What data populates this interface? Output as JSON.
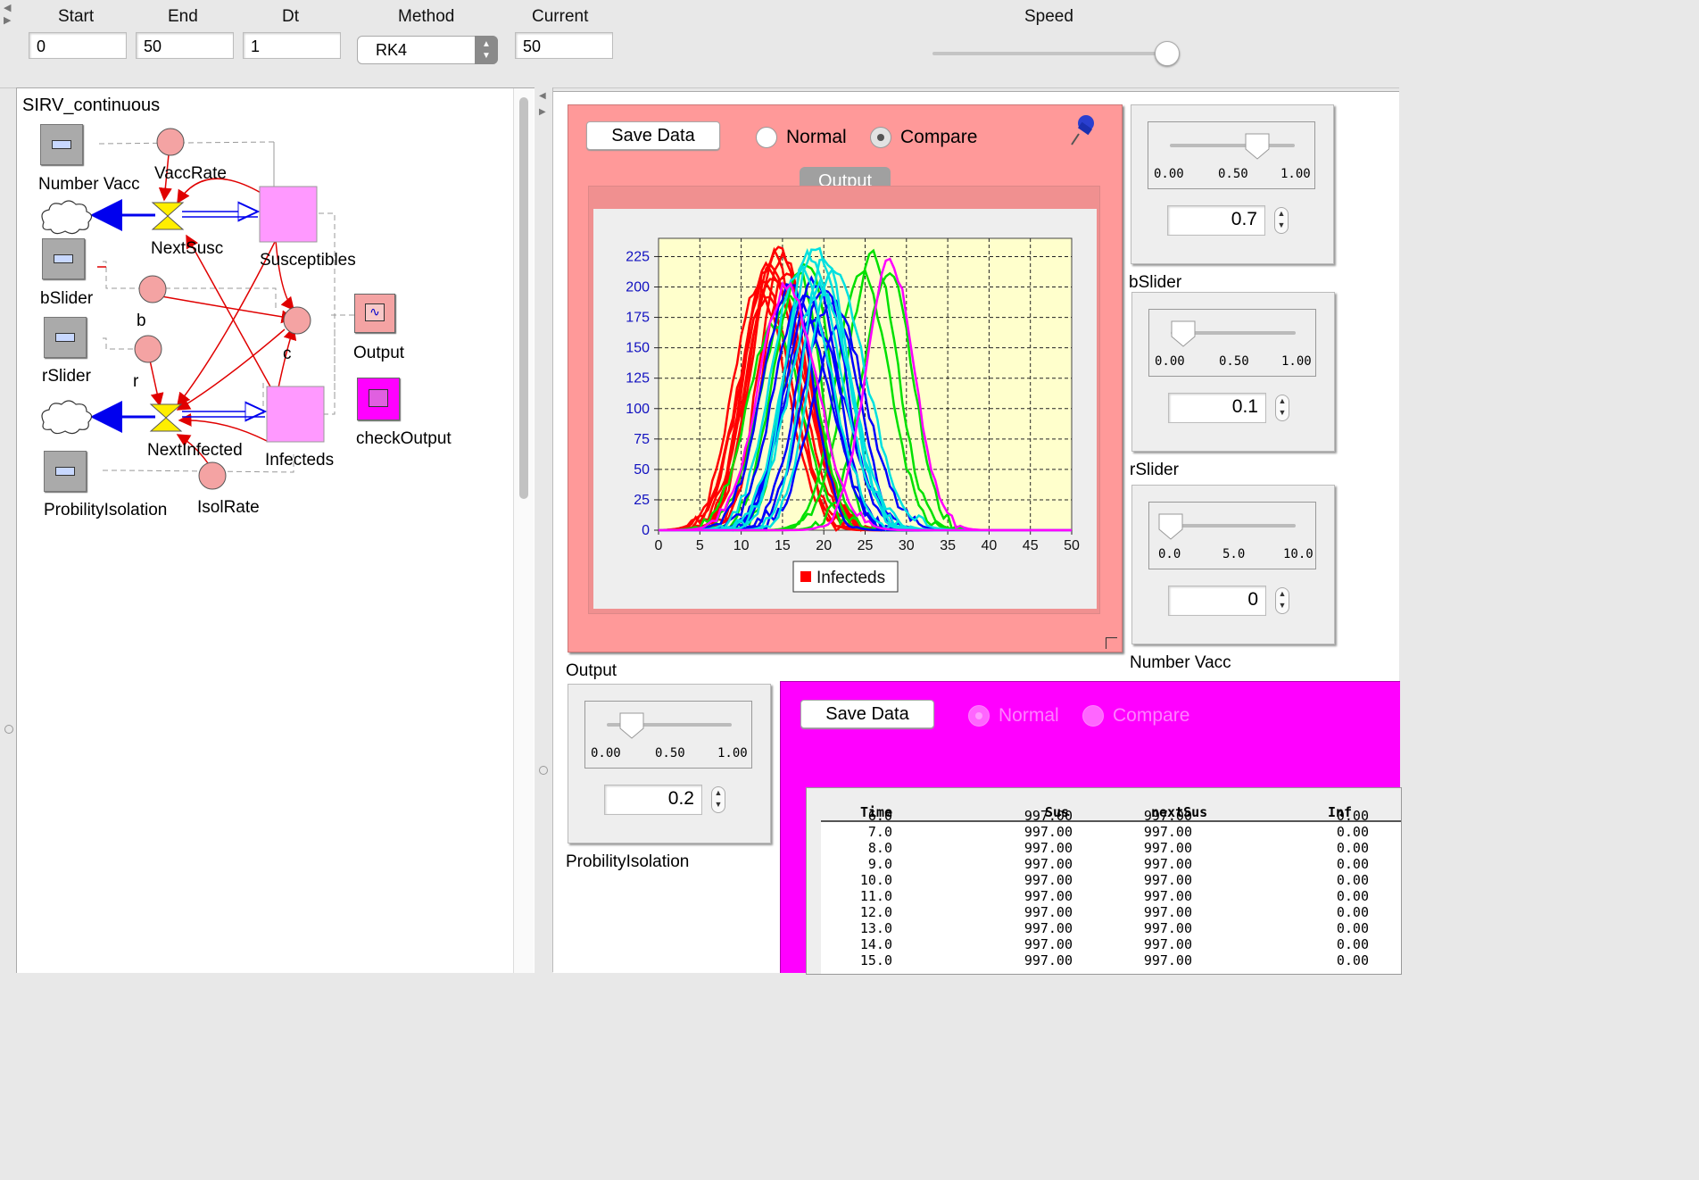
{
  "toolbar": {
    "start_label": "Start",
    "start_value": "0",
    "end_label": "End",
    "end_value": "50",
    "dt_label": "Dt",
    "dt_value": "1",
    "method_label": "Method",
    "method_value": "RK4",
    "current_label": "Current",
    "current_value": "50",
    "speed_label": "Speed",
    "speed_level": 0.97
  },
  "model": {
    "title": "SIRV_continuous",
    "nodes": {
      "number_vacc": "Number Vacc",
      "vacc_rate": "VaccRate",
      "next_susc": "NextSusc",
      "susceptibles": "Susceptibles",
      "bslider": "bSlider",
      "b": "b",
      "c": "c",
      "output": "Output",
      "rslider": "rSlider",
      "r": "r",
      "next_infected": "NextInfected",
      "infecteds": "Infecteds",
      "check_output": "checkOutput",
      "probility_isolation": "ProbilityIsolation",
      "isol_rate": "IsolRate"
    }
  },
  "output_panel": {
    "save_label": "Save Data",
    "normal_label": "Normal",
    "compare_label": "Compare",
    "selected_mode": "Compare",
    "tab_label": "Output",
    "caption": "Output"
  },
  "chart_data": {
    "type": "line",
    "title": "",
    "xlabel": "",
    "ylabel": "",
    "xlim": [
      0,
      50
    ],
    "ylim": [
      0,
      240
    ],
    "x_ticks": [
      0,
      5,
      10,
      15,
      20,
      25,
      30,
      35,
      40,
      45,
      50
    ],
    "y_ticks": [
      0,
      25,
      50,
      75,
      100,
      125,
      150,
      175,
      200,
      225
    ],
    "grid": true,
    "legend": {
      "position": "bottom-center",
      "entries": [
        "Infecteds"
      ]
    },
    "series_colors": [
      "#ff0000",
      "#00e000",
      "#0000ff",
      "#00e0e0",
      "#ff00ff"
    ],
    "series": [
      {
        "name": "Infecteds",
        "color": "#ff0000",
        "peaks": [
          [
            12,
            200
          ],
          [
            13,
            220
          ],
          [
            13.5,
            215
          ],
          [
            14,
            228
          ],
          [
            14.5,
            230
          ],
          [
            15,
            225
          ],
          [
            13,
            190
          ],
          [
            14,
            210
          ],
          [
            15.5,
            215
          ],
          [
            12.5,
            205
          ]
        ]
      },
      {
        "color": "#00e000",
        "peaks": [
          [
            14,
            170
          ],
          [
            16,
            195
          ],
          [
            17,
            210
          ],
          [
            18,
            220
          ],
          [
            24.5,
            215
          ],
          [
            26,
            225
          ],
          [
            28,
            215
          ]
        ]
      },
      {
        "color": "#0000ff",
        "peaks": [
          [
            16,
            200
          ],
          [
            17,
            185
          ],
          [
            18,
            195
          ],
          [
            19,
            205
          ],
          [
            20,
            200
          ],
          [
            21,
            190
          ],
          [
            22,
            165
          ],
          [
            18.5,
            170
          ]
        ]
      },
      {
        "color": "#00e0e0",
        "peaks": [
          [
            17,
            215
          ],
          [
            18,
            225
          ],
          [
            19,
            230
          ],
          [
            20,
            225
          ],
          [
            21,
            215
          ],
          [
            19.5,
            200
          ]
        ]
      },
      {
        "color": "#ff00ff",
        "peaks": [
          [
            15.5,
            200
          ],
          [
            28,
            220
          ]
        ]
      }
    ]
  },
  "sliders": {
    "b_slider": {
      "ticks": [
        "0.00",
        "0.50",
        "1.00"
      ],
      "value": "0.7",
      "level": 0.7,
      "caption": "bSlider"
    },
    "r_slider": {
      "ticks": [
        "0.00",
        "0.50",
        "1.00"
      ],
      "value": "0.1",
      "level": 0.1,
      "caption": "rSlider"
    },
    "number_vacc": {
      "ticks": [
        "0.0",
        "5.0",
        "10.0"
      ],
      "value": "0",
      "level": 0.0,
      "caption": "Number Vacc"
    },
    "probility_isolation": {
      "ticks": [
        "0.00",
        "0.50",
        "1.00"
      ],
      "value": "0.2",
      "level": 0.2,
      "caption": "ProbilityIsolation"
    }
  },
  "check_panel": {
    "save_label": "Save Data",
    "normal_label": "Normal",
    "compare_label": "Compare",
    "table": {
      "headers": [
        "Time",
        "Sus",
        "nextSus",
        "Inf"
      ],
      "rows": [
        [
          "6.0",
          "997.00",
          "997.00",
          "0.00"
        ],
        [
          "7.0",
          "997.00",
          "997.00",
          "0.00"
        ],
        [
          "8.0",
          "997.00",
          "997.00",
          "0.00"
        ],
        [
          "9.0",
          "997.00",
          "997.00",
          "0.00"
        ],
        [
          "10.0",
          "997.00",
          "997.00",
          "0.00"
        ],
        [
          "11.0",
          "997.00",
          "997.00",
          "0.00"
        ],
        [
          "12.0",
          "997.00",
          "997.00",
          "0.00"
        ],
        [
          "13.0",
          "997.00",
          "997.00",
          "0.00"
        ],
        [
          "14.0",
          "997.00",
          "997.00",
          "0.00"
        ],
        [
          "15.0",
          "997.00",
          "997.00",
          "0.00"
        ]
      ]
    }
  }
}
